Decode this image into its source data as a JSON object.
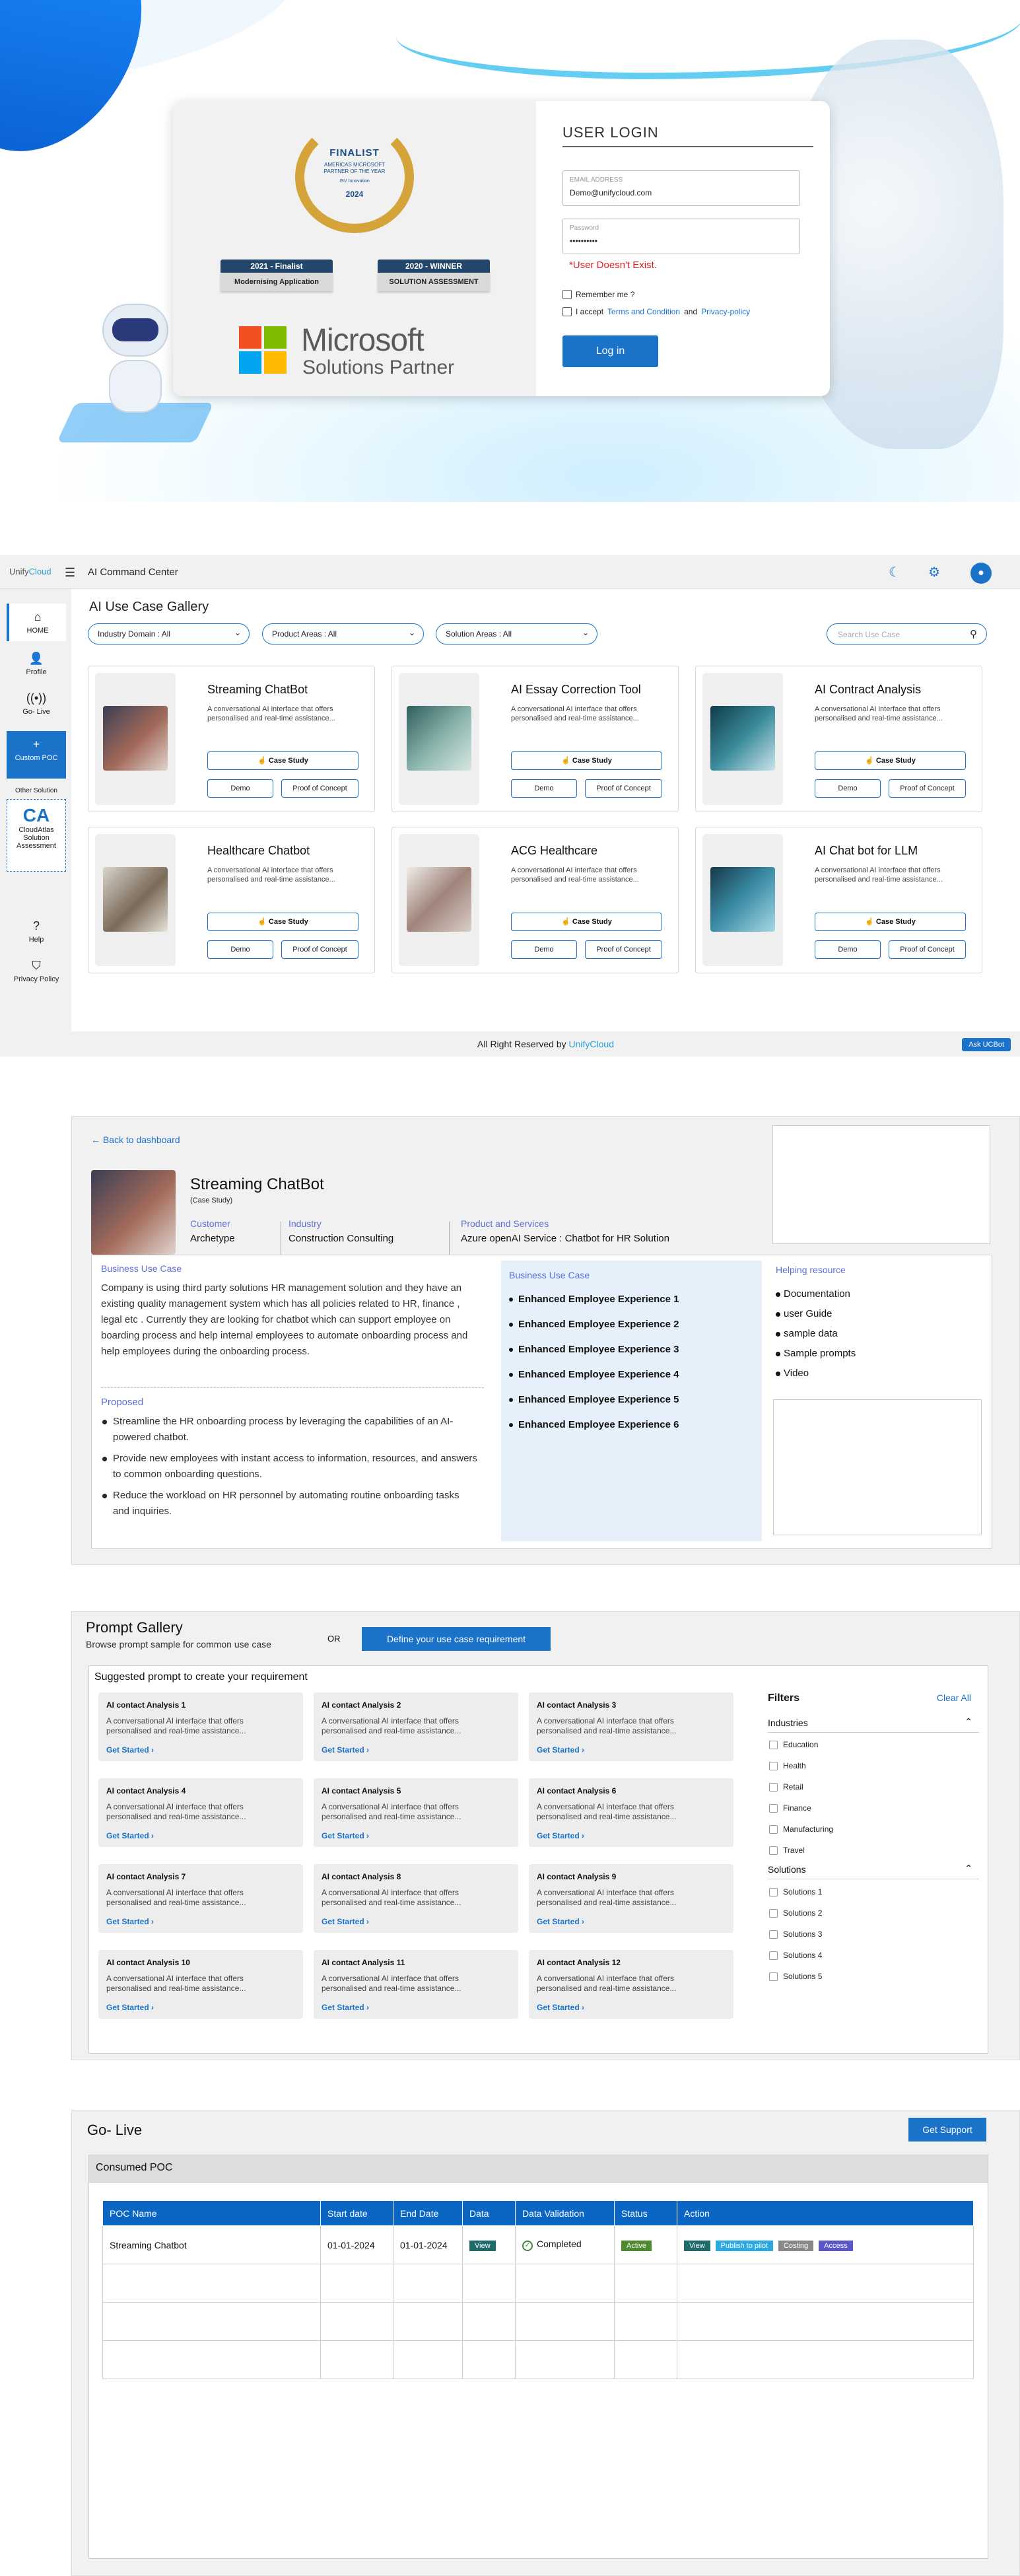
{
  "login": {
    "finalist": "FINALIST",
    "award_line1": "AMERICAS MICROSOFT PARTNER OF THE YEAR",
    "award_line2": "ISV Innovation",
    "award_year": "2024",
    "badge1_top": "2021 - Finalist",
    "badge1_bottom": "Modernising Application",
    "badge2_top": "2020 - WINNER",
    "badge2_bottom": "SOLUTION ASSESSMENT",
    "ms_title": "Microsoft",
    "ms_sub": "Solutions Partner",
    "title": "USER LOGIN",
    "email_label": "EMAIL ADDRESS",
    "email_value": "Demo@unifycloud.com",
    "password_label": "Password",
    "password_value": "••••••••••",
    "error": "*User Doesn't Exist.",
    "remember": "Remember me ?",
    "accept_prefix": "I accept",
    "terms": "Terms and Condition",
    "and": "and",
    "privacy": "Privacy-policy",
    "login_button": "Log in"
  },
  "dashboard": {
    "brand_a": "Unify",
    "brand_b": "Cloud",
    "app_title": "AI Command Center",
    "sidebar": {
      "home": "HOME",
      "profile": "Profile",
      "golive": "Go- Live",
      "custom_poc": "Custom POC",
      "other_solution": "Other Solution",
      "ca_logo": "CA",
      "ca_label": "CloudAtlas Solution Assessment",
      "help": "Help",
      "privacy": "Privacy Policy"
    },
    "title": "AI Use Case Gallery",
    "filters": [
      "Industry Domain : All",
      "Product Areas : All",
      "Solution Areas : All"
    ],
    "search_placeholder": "Search Use Case",
    "card_desc": "A conversational AI interface that offers personalised and real-time assistance...",
    "case_study": "Case Study",
    "demo": "Demo",
    "poc": "Proof of Concept",
    "cards": [
      "Streaming ChatBot",
      "AI Essay Correction Tool",
      "AI Contract Analysis",
      "Healthcare Chatbot",
      "ACG Healthcare",
      "AI Chat bot for LLM"
    ],
    "footer_prefix": "All Right Reserved by",
    "footer_brand": "UnifyCloud",
    "ask": "Ask UCBot"
  },
  "detail": {
    "back": "Back to dashboard",
    "title": "Streaming ChatBot",
    "subtitle": "(Case Study)",
    "customer_label": "Customer",
    "customer_value": "Archetype",
    "industry_label": "Industry",
    "industry_value": "Construction Consulting",
    "product_label": "Product and Services",
    "product_value": "Azure openAI Service : Chatbot for HR Solution",
    "bu_title": "Business Use Case",
    "bu_text": "Company is using third party solutions HR management solution and they have an existing quality management system which has all policies related to HR, finance , legal etc . Currently they are looking for chatbot which can support employee on boarding process and help internal employees to automate onboarding process and help employees during the onboarding process.",
    "proposed": "Proposed",
    "proposed_items": [
      "Streamline the HR onboarding process by leveraging the capabilities of an AI-powered chatbot.",
      "Provide new employees with instant access to information, resources, and answers to common onboarding questions.",
      "Reduce the workload on HR personnel by automating routine onboarding tasks and inquiries."
    ],
    "bu_title2": "Business Use Case",
    "experiences": [
      "Enhanced Employee Experience 1",
      "Enhanced Employee Experience 2",
      "Enhanced Employee Experience 3",
      "Enhanced Employee Experience 4",
      "Enhanced Employee Experience 5",
      "Enhanced Employee Experience 6"
    ],
    "helping_title": "Helping resource",
    "helping": [
      "Documentation",
      "user Guide",
      "sample data",
      "Sample prompts",
      "Video"
    ]
  },
  "prompt": {
    "title": "Prompt Gallery",
    "subtitle": "Browse prompt sample for common use case",
    "or": "OR",
    "define_button": "Define your use case requirement",
    "suggested": "Suggested prompt to create your requirement",
    "card_desc": "A conversational AI interface that offers personalised and real-time assistance...",
    "get_started": "Get Started",
    "cards": [
      "AI contact Analysis 1",
      "AI contact Analysis 2",
      "AI contact Analysis 3",
      "AI contact Analysis 4",
      "AI contact Analysis 5",
      "AI contact Analysis 6",
      "AI contact Analysis 7",
      "AI contact Analysis 8",
      "AI contact Analysis 9",
      "AI contact Analysis 10",
      "AI contact Analysis 11",
      "AI contact Analysis 12"
    ],
    "filters_title": "Filters",
    "clear_all": "Clear All",
    "industries_title": "Industries",
    "industries": [
      "Education",
      "Health",
      "Retail",
      "Finance",
      "Manufacturing",
      "Travel"
    ],
    "solutions_title": "Solutions",
    "solutions": [
      "Solutions 1",
      "Solutions 2",
      "Solutions 3",
      "Solutions 4",
      "Solutions 5"
    ]
  },
  "golive": {
    "title": "Go- Live",
    "support_button": "Get Support",
    "panel_title": "Consumed POC",
    "columns": [
      "POC Name",
      "Start date",
      "End Date",
      "Data",
      "Data Validation",
      "Status",
      "Action"
    ],
    "row": {
      "name": "Streaming Chatbot",
      "start": "01-01-2024",
      "end": "01-01-2024",
      "data": "View",
      "validation": "Completed",
      "status": "Active",
      "actions": [
        "View",
        "Publish to pilot",
        "Costing",
        "Access"
      ]
    }
  },
  "colors": {
    "accent": "#1a73c9",
    "brand": "#2a9fd6",
    "error": "#e02020"
  }
}
